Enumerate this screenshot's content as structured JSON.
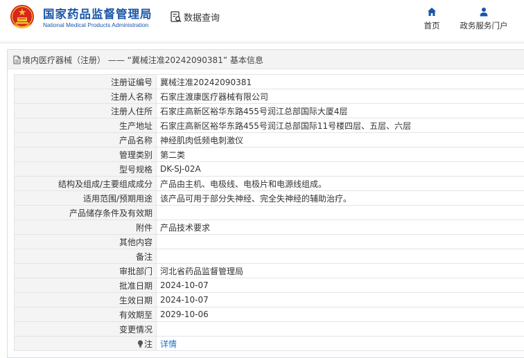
{
  "header": {
    "logo_cn": "国家药品监督管理局",
    "logo_en": "National Medical Products Administration",
    "query_label": "数据查询",
    "nav": [
      {
        "label": "首页",
        "icon": "home-icon"
      },
      {
        "label": "政务服务门户",
        "icon": "user-icon"
      }
    ]
  },
  "colors": {
    "brand_blue": "#1a56a8",
    "emblem_red": "#d7261e",
    "emblem_gold": "#f2c230",
    "link_blue": "#1a6fc4"
  },
  "panel": {
    "title": "境内医疗器械（注册） —— “冀械注准20242090381” 基本信息"
  },
  "rows": [
    {
      "label": "注册证编号",
      "value": "冀械注准20242090381"
    },
    {
      "label": "注册人名称",
      "value": "石家庄渡康医疗器械有限公司"
    },
    {
      "label": "注册人住所",
      "value": "石家庄高新区裕华东路455号润江总部国际大厦4层"
    },
    {
      "label": "生产地址",
      "value": "石家庄高新区裕华东路455号润江总部国际11号楼四层、五层、六层"
    },
    {
      "label": "产品名称",
      "value": "神经肌肉低频电刺激仪"
    },
    {
      "label": "管理类别",
      "value": "第二类"
    },
    {
      "label": "型号规格",
      "value": "DK-SJ-02A"
    },
    {
      "label": "结构及组成/主要组成成分",
      "value": "产品由主机、电极线、电极片和电源线组成。"
    },
    {
      "label": "适用范围/预期用途",
      "value": "该产品可用于部分失神经、完全失神经的辅助治疗。"
    },
    {
      "label": "产品储存条件及有效期",
      "value": ""
    },
    {
      "label": "附件",
      "value": "产品技术要求"
    },
    {
      "label": "其他内容",
      "value": ""
    },
    {
      "label": "备注",
      "value": ""
    },
    {
      "label": "审批部门",
      "value": "河北省药品监督管理局"
    },
    {
      "label": "批准日期",
      "value": "2024-10-07"
    },
    {
      "label": "生效日期",
      "value": "2024-10-07"
    },
    {
      "label": "有效期至",
      "value": "2029-10-06"
    },
    {
      "label": "变更情况",
      "value": ""
    }
  ],
  "note_row": {
    "label": "注",
    "link": "详情",
    "icon": "lightbulb-icon"
  }
}
